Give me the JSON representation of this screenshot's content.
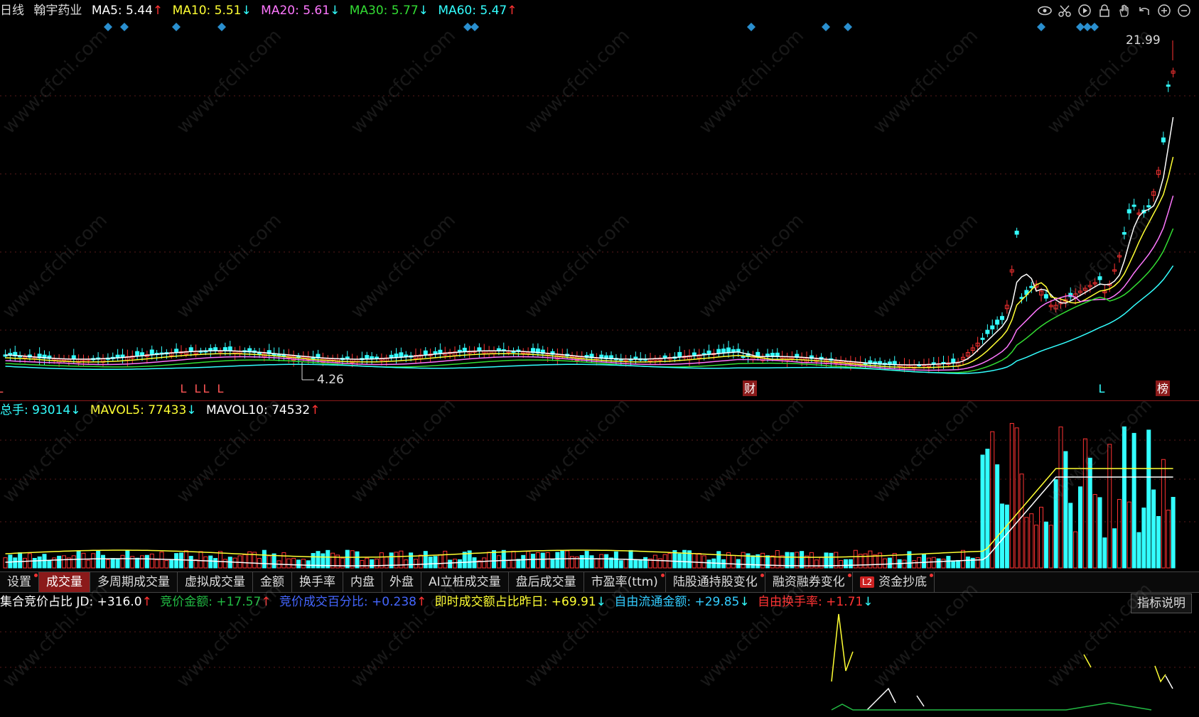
{
  "header": {
    "period": "日线",
    "stock_name": "翰宇药业",
    "ma5": {
      "label": "MA5: 5.44",
      "arrow": "↑",
      "color": "#ffffff",
      "arrow_color": "#ff3333"
    },
    "ma10": {
      "label": "MA10: 5.51",
      "arrow": "↓",
      "color": "#ffff33",
      "arrow_color": "#33ffff"
    },
    "ma20": {
      "label": "MA20: 5.61",
      "arrow": "↓",
      "color": "#ff77ff",
      "arrow_color": "#33ffff"
    },
    "ma30": {
      "label": "MA30: 5.77",
      "arrow": "↓",
      "color": "#33dd33",
      "arrow_color": "#33ffff"
    },
    "ma60": {
      "label": "MA60: 5.47",
      "arrow": "↑",
      "color": "#33ffff",
      "arrow_color": "#ff3333"
    }
  },
  "toolbar": [
    "eye-icon",
    "scissors-icon",
    "play-icon",
    "lock-icon",
    "hand-icon",
    "undo-icon",
    "zoom-in-icon",
    "zoom-out-icon"
  ],
  "price_chart": {
    "high_label": "21.99",
    "low_label": "4.26",
    "markers": [
      "L",
      "L",
      "L",
      "L",
      "L",
      "财",
      "L",
      "榜"
    ]
  },
  "volume_header": {
    "total": {
      "label": "总手: 93014",
      "arrow": "↓",
      "color": "#33ffff"
    },
    "mavol5": {
      "label": "MAVOL5: 77433",
      "arrow": "↓",
      "color": "#ffff33"
    },
    "mavol10": {
      "label": "MAVOL10: 74532",
      "arrow": "↑",
      "color": "#ffffff"
    }
  },
  "tabs": [
    {
      "label": "设置"
    },
    {
      "label": "成交量"
    },
    {
      "label": "多周期成交量"
    },
    {
      "label": "虚拟成交量"
    },
    {
      "label": "金额"
    },
    {
      "label": "换手率"
    },
    {
      "label": "内盘"
    },
    {
      "label": "外盘"
    },
    {
      "label": "AI立桩成交量"
    },
    {
      "label": "盘后成交量"
    },
    {
      "label": "市盈率(ttm)"
    },
    {
      "label": "陆股通持股变化"
    },
    {
      "label": "融资融券变化"
    },
    {
      "label": "资金抄底",
      "badge": "L2"
    }
  ],
  "indicator": {
    "title": "集合竞价占比 JD: +316.0",
    "title_arrow": "↑",
    "items": [
      {
        "label": "竞价金额: +17.57",
        "arrow": "↑",
        "color": "#22bb44"
      },
      {
        "label": "竞价成交百分比: +0.238",
        "arrow": "↑",
        "color": "#4466ff"
      },
      {
        "label": "即时成交额占比昨日: +69.91",
        "arrow": "↓",
        "color": "#ffff33"
      },
      {
        "label": "自由流通金额: +29.85",
        "arrow": "↓",
        "color": "#33ccff"
      },
      {
        "label": "自由换手率: +1.71",
        "arrow": "↓",
        "color": "#ff3333"
      }
    ],
    "explain_button": "指标说明"
  },
  "watermark": "www.cfchi.com",
  "colors": {
    "up": "#ff3333",
    "down": "#33ffff",
    "background": "#000000"
  }
}
